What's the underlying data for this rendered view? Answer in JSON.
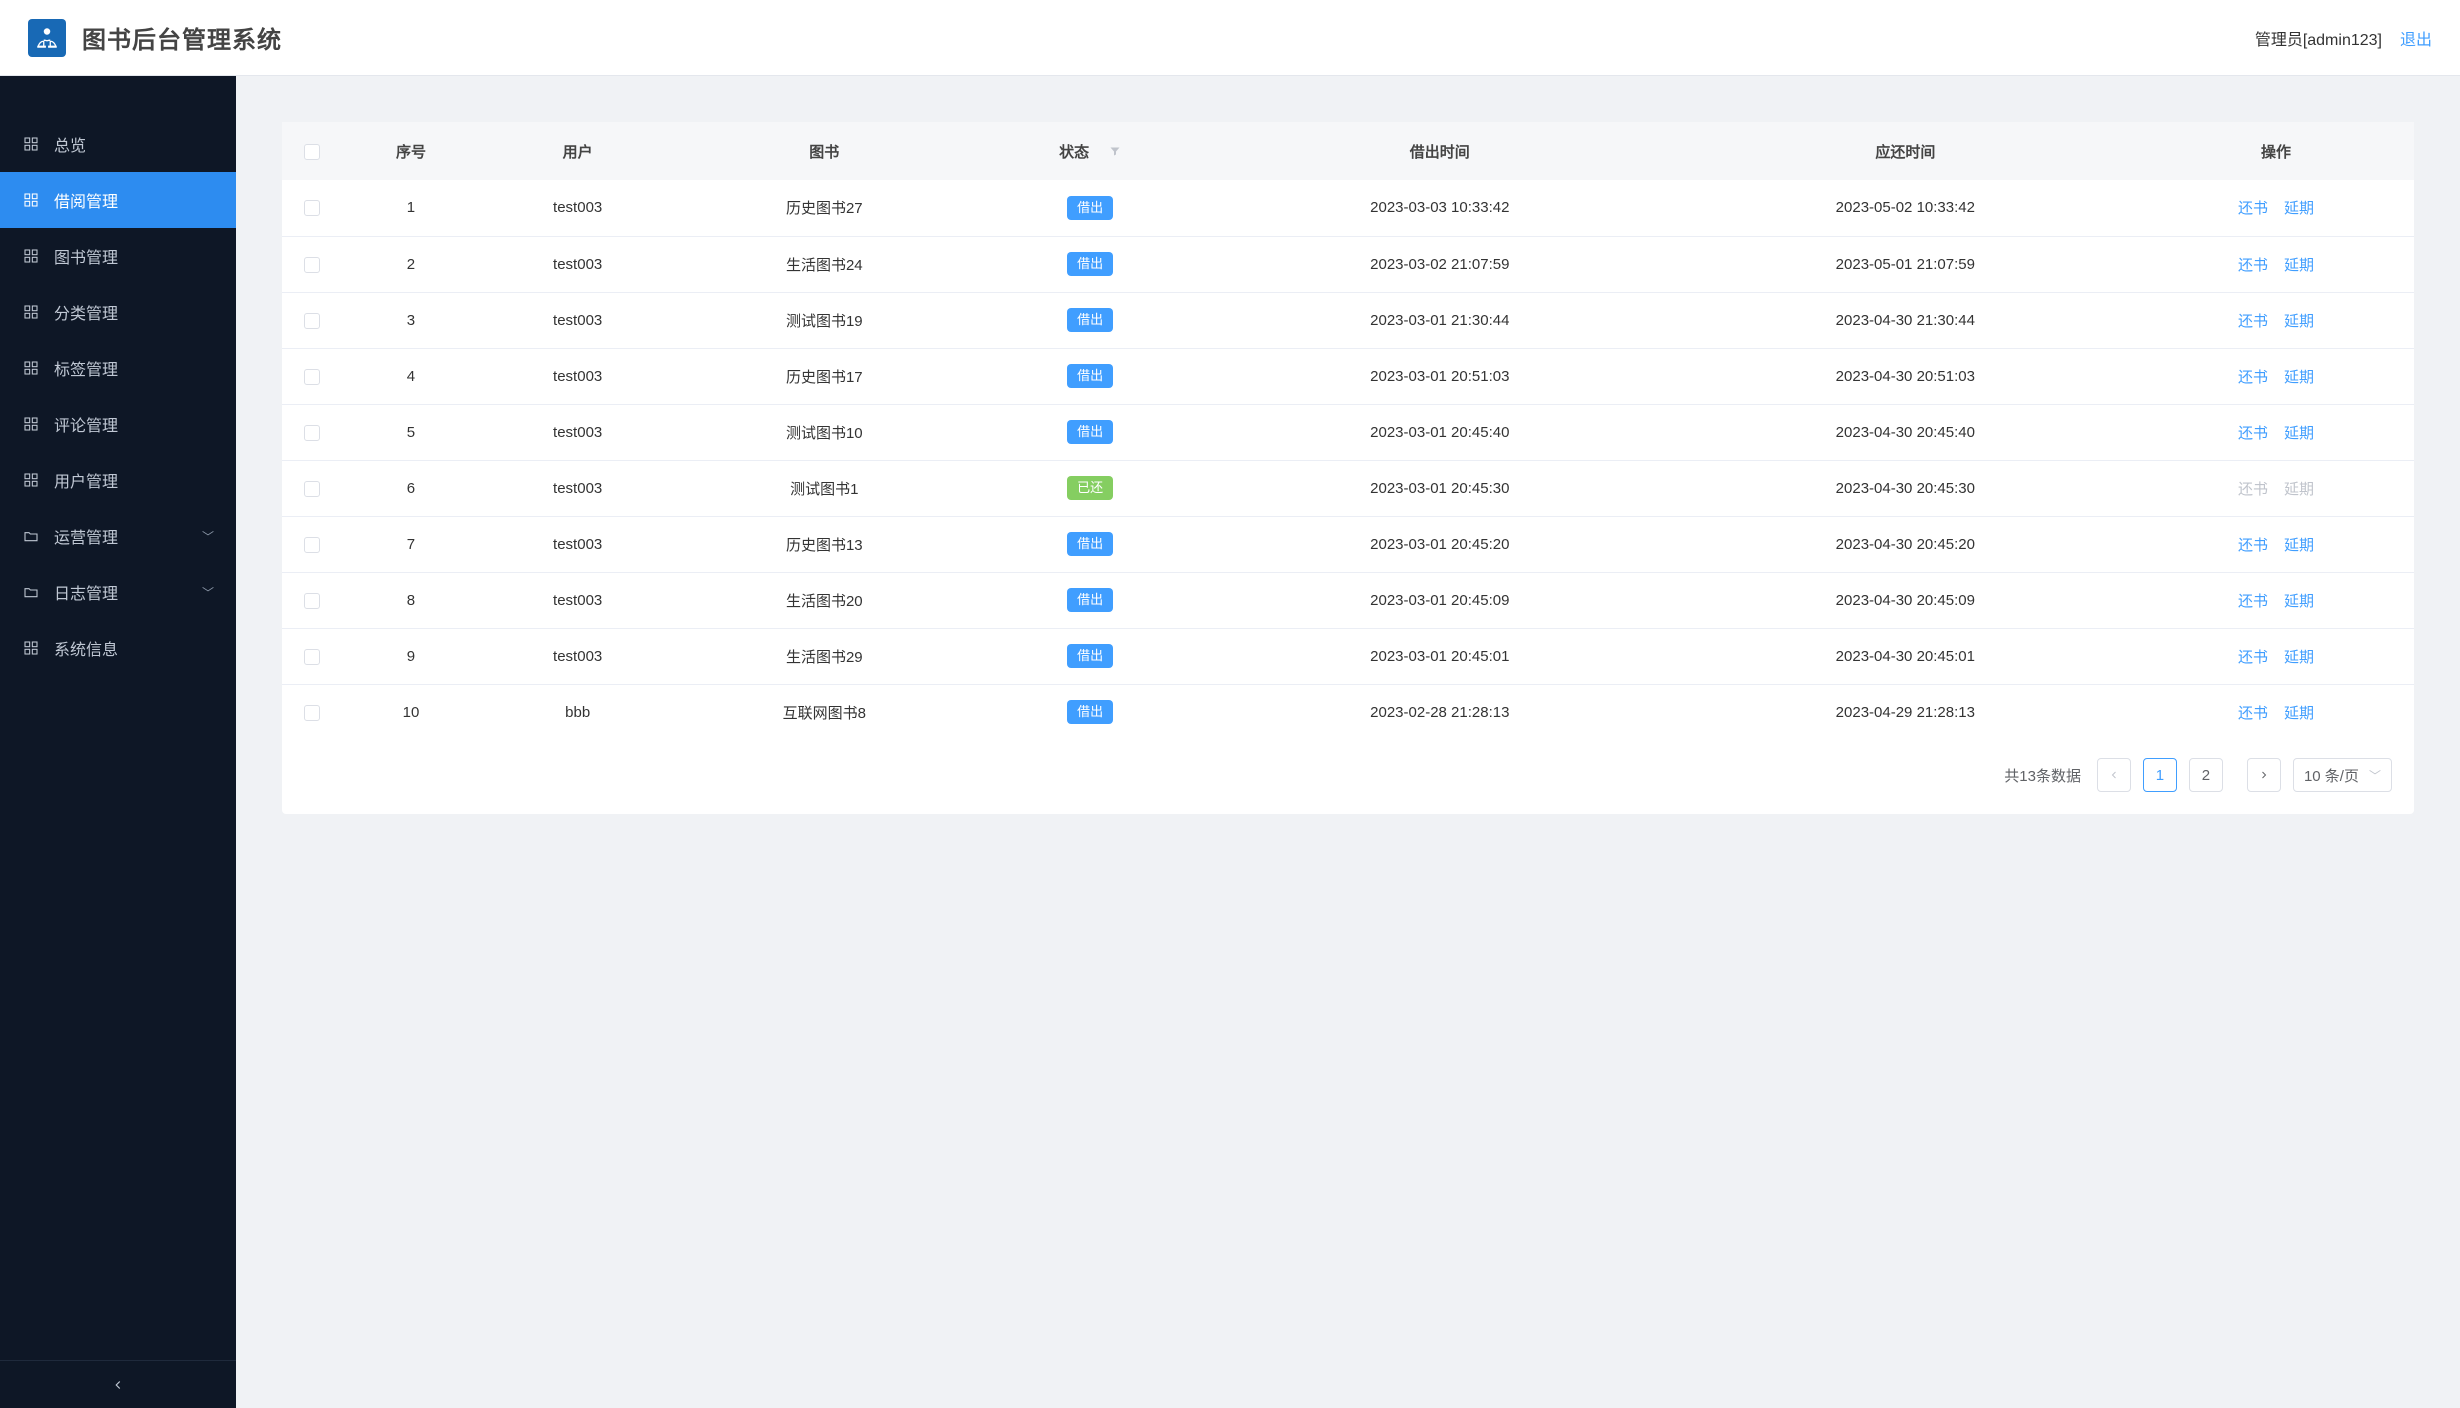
{
  "header": {
    "app_title": "图书后台管理系统",
    "admin_label": "管理员[admin123]",
    "logout": "退出"
  },
  "sidebar": {
    "items": [
      {
        "key": "overview",
        "label": "总览",
        "icon": "grid",
        "active": false,
        "expandable": false
      },
      {
        "key": "borrow",
        "label": "借阅管理",
        "icon": "grid",
        "active": true,
        "expandable": false
      },
      {
        "key": "books",
        "label": "图书管理",
        "icon": "grid",
        "active": false,
        "expandable": false
      },
      {
        "key": "category",
        "label": "分类管理",
        "icon": "grid",
        "active": false,
        "expandable": false
      },
      {
        "key": "tags",
        "label": "标签管理",
        "icon": "grid",
        "active": false,
        "expandable": false
      },
      {
        "key": "comments",
        "label": "评论管理",
        "icon": "grid",
        "active": false,
        "expandable": false
      },
      {
        "key": "users",
        "label": "用户管理",
        "icon": "grid",
        "active": false,
        "expandable": false
      },
      {
        "key": "operation",
        "label": "运营管理",
        "icon": "folder",
        "active": false,
        "expandable": true
      },
      {
        "key": "logs",
        "label": "日志管理",
        "icon": "folder",
        "active": false,
        "expandable": true
      },
      {
        "key": "system",
        "label": "系统信息",
        "icon": "grid",
        "active": false,
        "expandable": false
      }
    ]
  },
  "table": {
    "columns": {
      "seq": "序号",
      "user": "用户",
      "book": "图书",
      "status": "状态",
      "borrow_time": "借出时间",
      "due_time": "应还时间",
      "ops": "操作"
    },
    "status_labels": {
      "borrowed": "借出",
      "returned": "已还"
    },
    "op_labels": {
      "return": "还书",
      "extend": "延期"
    },
    "rows": [
      {
        "seq": 1,
        "user": "test003",
        "book": "历史图书27",
        "status": "borrowed",
        "borrow_time": "2023-03-03 10:33:42",
        "due_time": "2023-05-02 10:33:42",
        "ops_disabled": false
      },
      {
        "seq": 2,
        "user": "test003",
        "book": "生活图书24",
        "status": "borrowed",
        "borrow_time": "2023-03-02 21:07:59",
        "due_time": "2023-05-01 21:07:59",
        "ops_disabled": false
      },
      {
        "seq": 3,
        "user": "test003",
        "book": "测试图书19",
        "status": "borrowed",
        "borrow_time": "2023-03-01 21:30:44",
        "due_time": "2023-04-30 21:30:44",
        "ops_disabled": false
      },
      {
        "seq": 4,
        "user": "test003",
        "book": "历史图书17",
        "status": "borrowed",
        "borrow_time": "2023-03-01 20:51:03",
        "due_time": "2023-04-30 20:51:03",
        "ops_disabled": false
      },
      {
        "seq": 5,
        "user": "test003",
        "book": "测试图书10",
        "status": "borrowed",
        "borrow_time": "2023-03-01 20:45:40",
        "due_time": "2023-04-30 20:45:40",
        "ops_disabled": false
      },
      {
        "seq": 6,
        "user": "test003",
        "book": "测试图书1",
        "status": "returned",
        "borrow_time": "2023-03-01 20:45:30",
        "due_time": "2023-04-30 20:45:30",
        "ops_disabled": true
      },
      {
        "seq": 7,
        "user": "test003",
        "book": "历史图书13",
        "status": "borrowed",
        "borrow_time": "2023-03-01 20:45:20",
        "due_time": "2023-04-30 20:45:20",
        "ops_disabled": false
      },
      {
        "seq": 8,
        "user": "test003",
        "book": "生活图书20",
        "status": "borrowed",
        "borrow_time": "2023-03-01 20:45:09",
        "due_time": "2023-04-30 20:45:09",
        "ops_disabled": false
      },
      {
        "seq": 9,
        "user": "test003",
        "book": "生活图书29",
        "status": "borrowed",
        "borrow_time": "2023-03-01 20:45:01",
        "due_time": "2023-04-30 20:45:01",
        "ops_disabled": false
      },
      {
        "seq": 10,
        "user": "bbb",
        "book": "互联网图书8",
        "status": "borrowed",
        "borrow_time": "2023-02-28 21:28:13",
        "due_time": "2023-04-29 21:28:13",
        "ops_disabled": false
      }
    ]
  },
  "pagination": {
    "total_text": "共13条数据",
    "pages": [
      "1",
      "2"
    ],
    "current": "1",
    "page_size_label": "10 条/页"
  }
}
